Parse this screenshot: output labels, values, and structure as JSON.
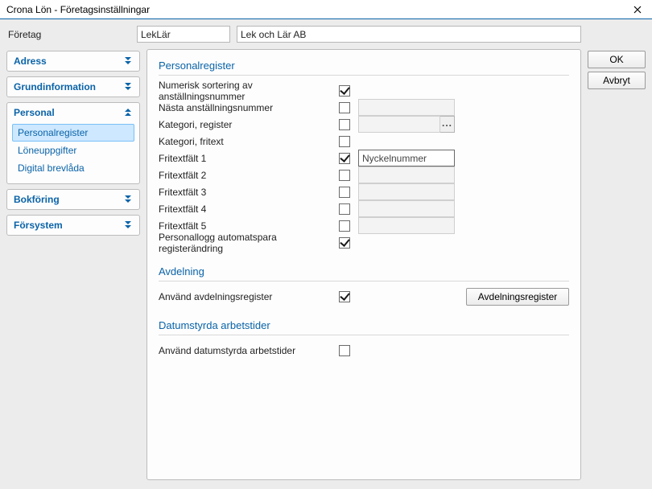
{
  "window": {
    "title": "Crona Lön - Företagsinställningar"
  },
  "header": {
    "label": "Företag",
    "company_code": "LekLär",
    "company_name": "Lek och Lär AB"
  },
  "sidebar": {
    "sections": [
      {
        "id": "adress",
        "label": "Adress",
        "expanded": false
      },
      {
        "id": "grund",
        "label": "Grundinformation",
        "expanded": false
      },
      {
        "id": "personal",
        "label": "Personal",
        "expanded": true,
        "items": [
          {
            "id": "personalregister",
            "label": "Personalregister",
            "selected": true
          },
          {
            "id": "loneuppgifter",
            "label": "Löneuppgifter"
          },
          {
            "id": "digitalbrevlada",
            "label": "Digital brevlåda"
          }
        ]
      },
      {
        "id": "bokforing",
        "label": "Bokföring",
        "expanded": false
      },
      {
        "id": "forsystem",
        "label": "Försystem",
        "expanded": false
      }
    ]
  },
  "main": {
    "group_personalregister_title": "Personalregister",
    "rows": {
      "num_sort": {
        "label": "Numerisk sortering av anställningsnummer",
        "checked": true
      },
      "nextnr": {
        "label": "Nästa anställningsnummer",
        "checked": false,
        "value": ""
      },
      "kat_reg": {
        "label": "Kategori, register",
        "checked": false,
        "value": ""
      },
      "kat_fri": {
        "label": "Kategori, fritext",
        "checked": false
      },
      "fri1": {
        "label": "Fritextfält 1",
        "checked": true,
        "value": "Nyckelnummer"
      },
      "fri2": {
        "label": "Fritextfält 2",
        "checked": false,
        "value": ""
      },
      "fri3": {
        "label": "Fritextfält 3",
        "checked": false,
        "value": ""
      },
      "fri4": {
        "label": "Fritextfält 4",
        "checked": false,
        "value": ""
      },
      "fri5": {
        "label": "Fritextfält 5",
        "checked": false,
        "value": ""
      },
      "autolog": {
        "label": "Personallogg automatspara registerändring",
        "checked": true
      }
    },
    "group_avdelning_title": "Avdelning",
    "avdelning": {
      "label": "Använd avdelningsregister",
      "checked": true,
      "button": "Avdelningsregister"
    },
    "group_datum_title": "Datumstyrda arbetstider",
    "datum": {
      "label": "Använd datumstyrda arbetstider",
      "checked": false
    }
  },
  "actions": {
    "ok": "OK",
    "cancel": "Avbryt"
  }
}
